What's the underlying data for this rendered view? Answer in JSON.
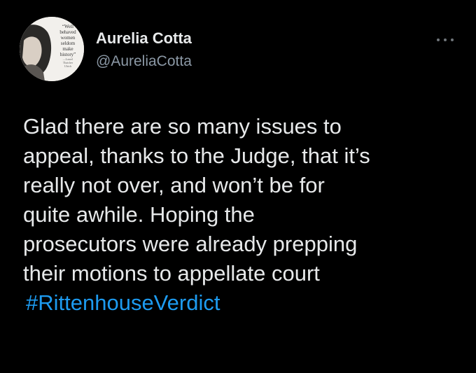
{
  "colors": {
    "background": "#000000",
    "text": "#e7e9ea",
    "secondary": "#8b98a5",
    "link": "#1d9bf0"
  },
  "author": {
    "display_name": "Aurelia Cotta",
    "handle": "@AureliaCotta",
    "avatar_quote": [
      "“Well",
      "behaved",
      "women",
      "seldom",
      "make",
      "history”"
    ],
    "avatar_attribution": [
      "—Laurel",
      "Thatcher",
      "Ulrich"
    ]
  },
  "menu": {
    "icon": "more-horizontal-icon"
  },
  "tweet": {
    "lines": [
      "Glad there are so many issues to",
      "appeal, thanks to the Judge, that it’s",
      "really not over, and won’t be for",
      "quite awhile. Hoping the",
      "prosecutors were already prepping",
      "their motions to appellate court"
    ],
    "hashtag": "#RittenhouseVerdict"
  }
}
